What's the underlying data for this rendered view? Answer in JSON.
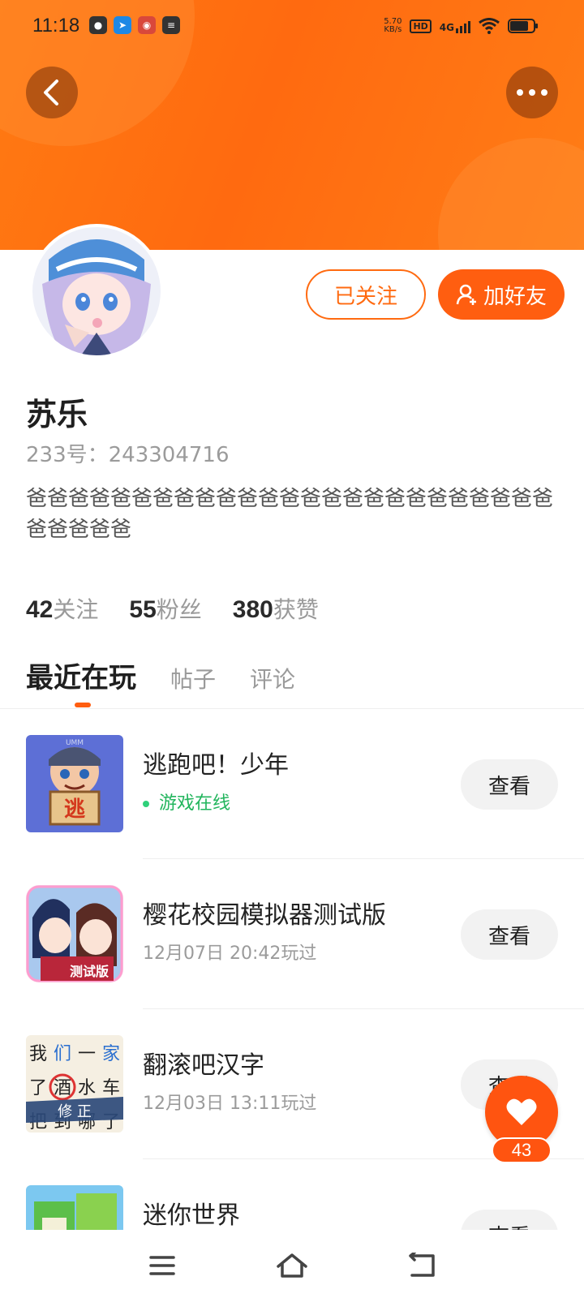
{
  "status_bar": {
    "time": "11:18",
    "net_speed_value": "5.70",
    "net_speed_unit": "KB/s",
    "hd_label": "HD",
    "signal_label": "4G",
    "left_icons": [
      "wechat-icon",
      "telegram-icon",
      "red-app-icon",
      "calendar-icon"
    ]
  },
  "header": {
    "back_icon": "chevron-left-icon",
    "more_icon": "more-dots-icon",
    "accent_color": "#ff6a10"
  },
  "profile": {
    "name": "苏乐",
    "id_text": "233号：243304716",
    "bio": "爸爸爸爸爸爸爸爸爸爸爸爸爸爸爸爸爸爸爸爸爸爸爸爸爸爸爸爸爸爸",
    "follow_label": "已关注",
    "add_friend_label": "加好友"
  },
  "stats": [
    {
      "value": "42",
      "label": "关注"
    },
    {
      "value": "55",
      "label": "粉丝"
    },
    {
      "value": "380",
      "label": "获赞"
    }
  ],
  "tabs": [
    "最近在玩",
    "帖子",
    "评论"
  ],
  "games": [
    {
      "title": "逃跑吧！少年",
      "subtitle": "游戏在线",
      "button": "查看"
    },
    {
      "title": "樱花校园模拟器测试版",
      "subtitle": "12月07日 20:42玩过",
      "button": "查看"
    },
    {
      "title": "翻滚吧汉字",
      "subtitle": "12月03日 13:11玩过",
      "button": "查看"
    },
    {
      "title": "迷你世界",
      "subtitle": "",
      "button": "查看"
    }
  ],
  "game_icon_texts": {
    "escape_sign": "逃",
    "umm_label": "UMM",
    "sakura_badge": "测试版",
    "hanzi_grid": [
      "我",
      "们",
      "一",
      "家",
      "了",
      "酒",
      "水",
      "车",
      "把",
      "到",
      "哪",
      "了"
    ],
    "hanzi_banner": "修 正"
  },
  "fab": {
    "count": "43",
    "icon": "heart-icon"
  },
  "navbar": {
    "icons": [
      "menu-icon",
      "home-icon",
      "back-icon"
    ]
  }
}
